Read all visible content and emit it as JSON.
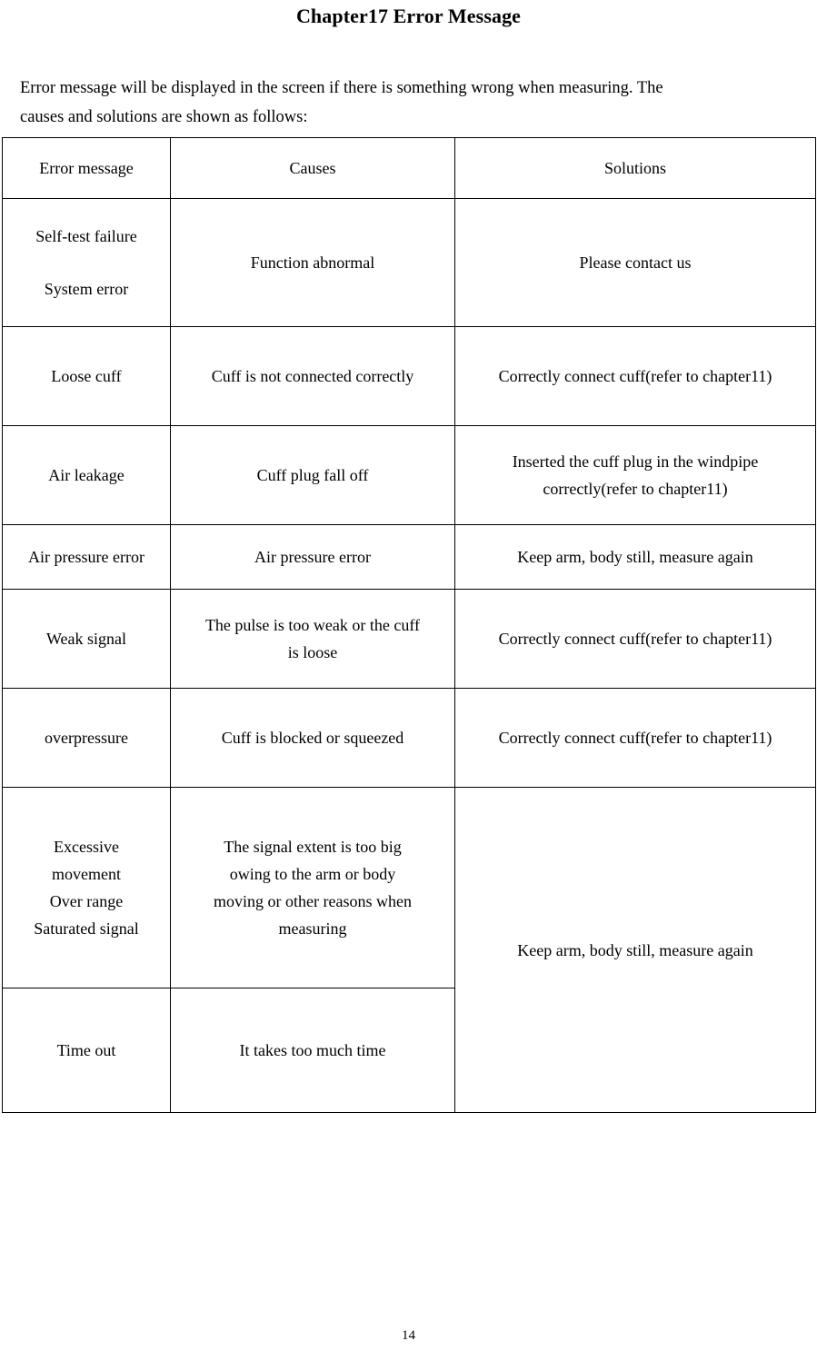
{
  "document": {
    "title": "Chapter17 Error Message",
    "intro_line_1": "Error message will be displayed in the screen if there is something wrong when measuring. The",
    "intro_line_2": "causes and solutions are shown as follows:",
    "page_number": "14"
  },
  "table": {
    "headers": {
      "error_message": "Error message",
      "causes": "Causes",
      "solutions": "Solutions"
    },
    "rows": [
      {
        "error_message_line_1": "Self-test failure",
        "error_message_line_2": "System error",
        "causes": "Function abnormal",
        "solutions": "Please contact us"
      },
      {
        "error_message": "Loose cuff",
        "causes": "Cuff is not connected correctly",
        "solutions": "Correctly connect cuff(refer to chapter11)"
      },
      {
        "error_message": "Air leakage",
        "causes": "Cuff plug fall off",
        "solutions_line_1": "Inserted the cuff plug in the windpipe",
        "solutions_line_2": "correctly(refer to chapter11)"
      },
      {
        "error_message": "Air pressure error",
        "causes": "Air pressure error",
        "solutions": "Keep arm, body still, measure again"
      },
      {
        "error_message": "Weak signal",
        "causes_line_1": "The pulse is too weak or the cuff",
        "causes_line_2": "is loose",
        "solutions": "Correctly connect cuff(refer to chapter11)"
      },
      {
        "error_message": "overpressure",
        "causes": "Cuff is blocked or squeezed",
        "solutions": "Correctly connect cuff(refer to chapter11)"
      },
      {
        "error_message_line_1": "Excessive",
        "error_message_line_2": "movement",
        "error_message_line_3": "Over range",
        "error_message_line_4": "Saturated signal",
        "causes_line_1": "The signal extent is too big",
        "causes_line_2": "owing to the arm or body",
        "causes_line_3": "moving or other reasons when",
        "causes_line_4": "measuring",
        "solutions_merged": "Keep arm, body still, measure again"
      },
      {
        "error_message": "Time out",
        "causes": "It takes too much time"
      }
    ]
  }
}
